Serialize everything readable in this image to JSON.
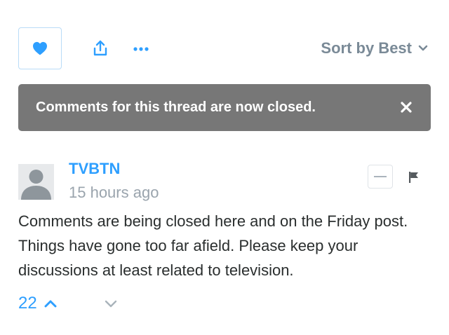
{
  "toolbar": {
    "heart_icon": "heart-icon",
    "share_icon": "share-icon",
    "more_icon": "ellipsis-icon",
    "sort_label": "Sort by Best",
    "accent": "#2e9fff"
  },
  "banner": {
    "text": "Comments for this thread are now closed.",
    "close_icon": "close-icon",
    "background": "#777777"
  },
  "comment": {
    "author": "TVBTN",
    "time": "15 hours ago",
    "body": "Comments are being closed here and on the Friday post. Things have gone too far afield. Please keep your discussions at least related to television.",
    "upvotes": "22",
    "actions": {
      "collapse_icon": "minus-icon",
      "flag_icon": "flag-icon"
    }
  }
}
